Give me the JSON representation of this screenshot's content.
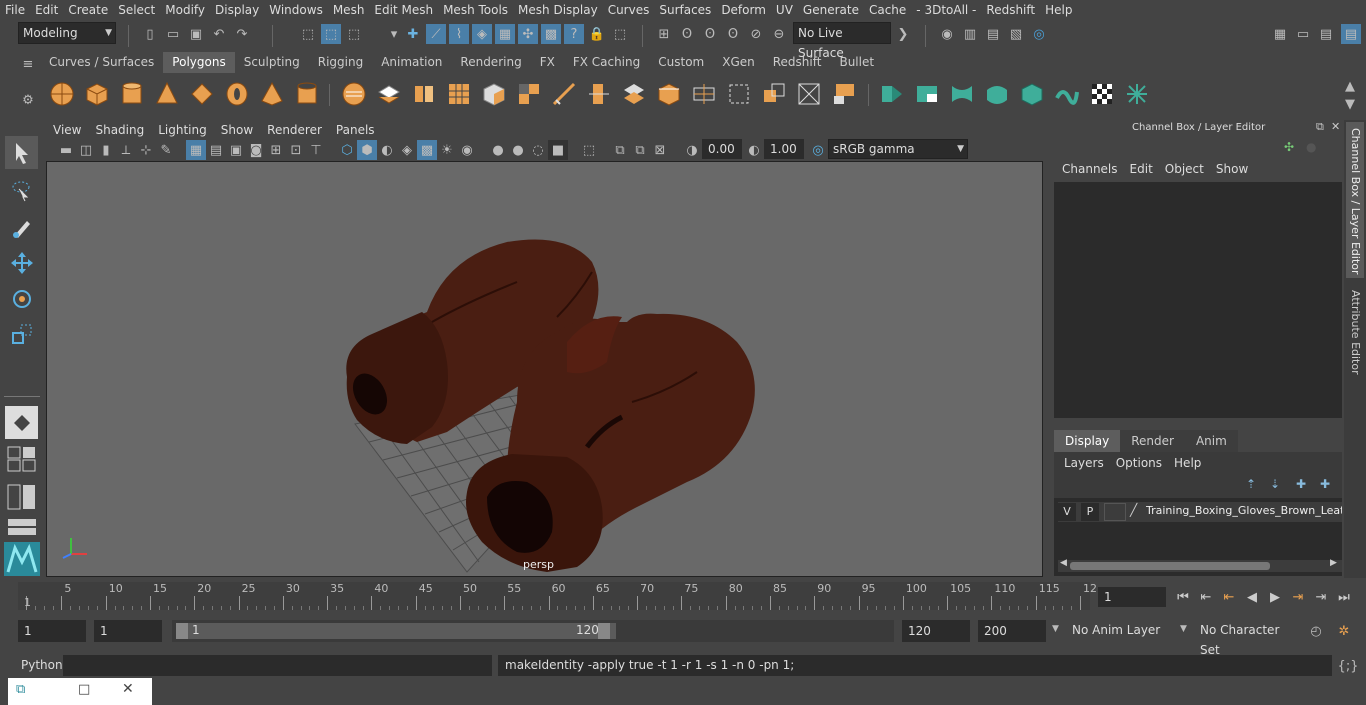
{
  "menubar": [
    "File",
    "Edit",
    "Create",
    "Select",
    "Modify",
    "Display",
    "Windows",
    "Mesh",
    "Edit Mesh",
    "Mesh Tools",
    "Mesh Display",
    "Curves",
    "Surfaces",
    "Deform",
    "UV",
    "Generate",
    "Cache",
    "- 3DtoAll -",
    "Redshift",
    "Help"
  ],
  "mode": "Modeling",
  "live_surface": "No Live Surface",
  "shelf_tabs": [
    "Curves / Surfaces",
    "Polygons",
    "Sculpting",
    "Rigging",
    "Animation",
    "Rendering",
    "FX",
    "FX Caching",
    "Custom",
    "XGen",
    "Redshift",
    "Bullet"
  ],
  "shelf_active": "Polygons",
  "viewport_menu": [
    "View",
    "Shading",
    "Lighting",
    "Show",
    "Renderer",
    "Panels"
  ],
  "exposure": "0.00",
  "gamma": "1.00",
  "color_space": "sRGB gamma",
  "camera_label": "persp",
  "panel_title": "Channel Box / Layer Editor",
  "channel_menu": [
    "Channels",
    "Edit",
    "Object",
    "Show"
  ],
  "layer_tabs": [
    "Display",
    "Render",
    "Anim"
  ],
  "layer_tab_active": "Display",
  "layer_menu": [
    "Layers",
    "Options",
    "Help"
  ],
  "layer": {
    "v": "V",
    "p": "P",
    "name": "Training_Boxing_Gloves_Brown_Leath"
  },
  "side_tabs": [
    "Channel Box / Layer Editor",
    "Attribute Editor"
  ],
  "timeline": {
    "ticks": [
      "1",
      "5",
      "10",
      "15",
      "20",
      "25",
      "30",
      "35",
      "40",
      "45",
      "50",
      "55",
      "60",
      "65",
      "70",
      "75",
      "80",
      "85",
      "90",
      "95",
      "100",
      "105",
      "110",
      "115",
      "12"
    ],
    "current_frame": "1"
  },
  "range": {
    "start": "1",
    "start2": "1",
    "slider_start": "1",
    "slider_end": "120",
    "end": "120",
    "max": "200",
    "anim_layer": "No Anim Layer",
    "char_set": "No Character Set"
  },
  "cmd": {
    "lang": "Python",
    "output": "makeIdentity -apply true -t 1 -r 1 -s 1 -n 0 -pn 1;"
  },
  "colors": {
    "accent": "#4a7fa8",
    "glove": "#4a1e12",
    "viewport": "#696969"
  }
}
